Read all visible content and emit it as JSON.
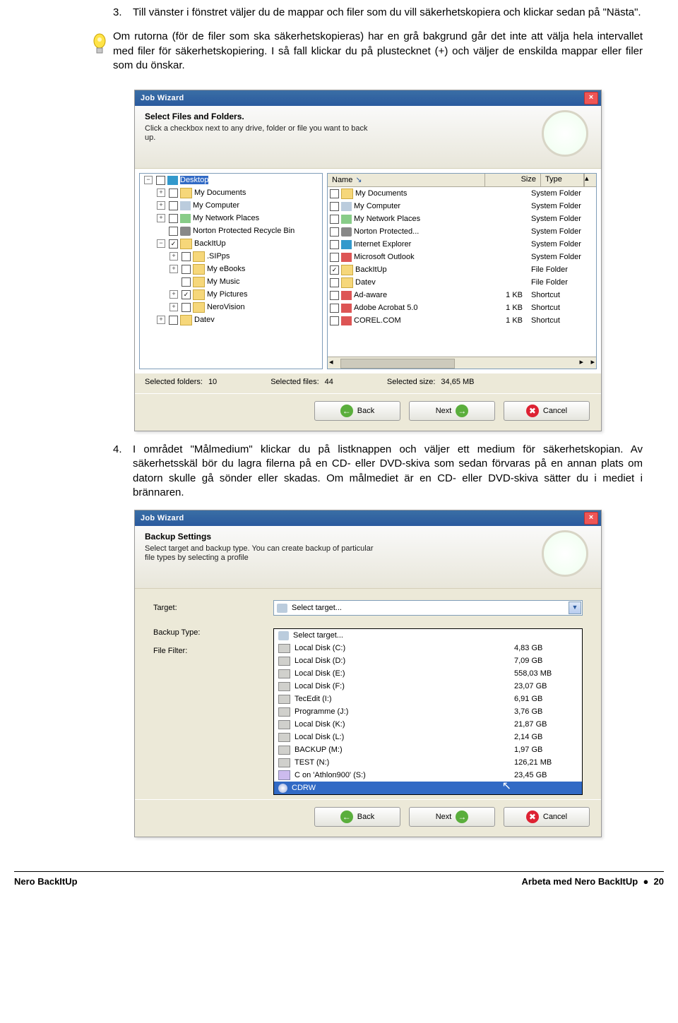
{
  "step3_num": "3.",
  "step3": "Till vänster i fönstret väljer du de mappar och filer som du vill säkerhetskopiera och klickar sedan på \"Nästa\".",
  "tip": "Om rutorna (för de filer som ska säkerhetskopieras) har en grå bakgrund går det inte att välja hela intervallet med filer för säkerhetskopiering. I så fall klickar du på plustecknet (+) och väljer de enskilda mappar eller filer som du önskar.",
  "wiz1": {
    "title": "Job Wizard",
    "btitle": "Select Files and Folders.",
    "bsub": "Click a checkbox next to any drive, folder or file you want to back up.",
    "cols": {
      "name": "Name",
      "size": "Size",
      "type": "Type"
    },
    "tree": [
      {
        "ind": 0,
        "exp": "−",
        "cb": "",
        "ico": "i-desktop",
        "label": "Desktop",
        "sel": true
      },
      {
        "ind": 1,
        "exp": "+",
        "cb": "",
        "ico": "i-folder",
        "label": "My Documents"
      },
      {
        "ind": 1,
        "exp": "+",
        "cb": "",
        "ico": "i-comp",
        "label": "My Computer"
      },
      {
        "ind": 1,
        "exp": "+",
        "cb": "",
        "ico": "i-net",
        "label": "My Network Places"
      },
      {
        "ind": 1,
        "exp": "",
        "cb": "",
        "ico": "i-bin",
        "label": "Norton Protected Recycle Bin"
      },
      {
        "ind": 1,
        "exp": "−",
        "cb": "✓",
        "ico": "i-folder",
        "label": "BackItUp"
      },
      {
        "ind": 2,
        "exp": "+",
        "cb": "",
        "ico": "i-folder",
        "label": ".SIPps"
      },
      {
        "ind": 2,
        "exp": "+",
        "cb": "",
        "ico": "i-folder",
        "label": "My eBooks"
      },
      {
        "ind": 2,
        "exp": "",
        "cb": "",
        "ico": "i-folder",
        "label": "My Music"
      },
      {
        "ind": 2,
        "exp": "+",
        "cb": "✓",
        "ico": "i-folder",
        "label": "My Pictures"
      },
      {
        "ind": 2,
        "exp": "+",
        "cb": "",
        "ico": "i-folder",
        "label": "NeroVision"
      },
      {
        "ind": 1,
        "exp": "+",
        "cb": "",
        "ico": "i-folder",
        "label": "Datev"
      }
    ],
    "list": [
      {
        "cb": "",
        "ico": "i-folder",
        "name": "My Documents",
        "size": "",
        "type": "System Folder"
      },
      {
        "cb": "",
        "ico": "i-comp",
        "name": "My Computer",
        "size": "",
        "type": "System Folder"
      },
      {
        "cb": "",
        "ico": "i-net",
        "name": "My Network Places",
        "size": "",
        "type": "System Folder"
      },
      {
        "cb": "",
        "ico": "i-bin",
        "name": "Norton Protected...",
        "size": "",
        "type": "System Folder"
      },
      {
        "cb": "",
        "ico": "i-desktop",
        "name": "Internet Explorer",
        "size": "",
        "type": "System Folder"
      },
      {
        "cb": "",
        "ico": "i-app",
        "name": "Microsoft Outlook",
        "size": "",
        "type": "System Folder"
      },
      {
        "cb": "✓",
        "ico": "i-folder",
        "name": "BackItUp",
        "size": "",
        "type": "File Folder"
      },
      {
        "cb": "",
        "ico": "i-folder",
        "name": "Datev",
        "size": "",
        "type": "File Folder"
      },
      {
        "cb": "",
        "ico": "i-app",
        "name": "Ad-aware",
        "size": "1 KB",
        "type": "Shortcut"
      },
      {
        "cb": "",
        "ico": "i-app",
        "name": "Adobe Acrobat 5.0",
        "size": "1 KB",
        "type": "Shortcut"
      },
      {
        "cb": "",
        "ico": "i-app",
        "name": "COREL.COM",
        "size": "1 KB",
        "type": "Shortcut"
      }
    ],
    "stats": {
      "sf_l": "Selected folders:",
      "sf_v": "10",
      "sfi_l": "Selected files:",
      "sfi_v": "44",
      "ss_l": "Selected size:",
      "ss_v": "34,65 MB"
    },
    "back": "Back",
    "next": "Next",
    "cancel": "Cancel"
  },
  "step4_num": "4.",
  "step4": "I området \"Målmedium\" klickar du på listknappen och väljer ett medium för säkerhetskopian. Av säkerhetsskäl bör du lagra filerna på en CD- eller DVD-skiva som sedan förvaras på en annan plats om datorn skulle gå sönder eller skadas. Om målmediet är en CD- eller DVD-skiva sätter du i mediet i brännaren.",
  "wiz2": {
    "title": "Job Wizard",
    "btitle": "Backup Settings",
    "bsub": "Select target and backup type. You can create backup of particular file types by selecting a profile",
    "target_l": "Target:",
    "target_v": "Select target...",
    "btype_l": "Backup Type:",
    "filter_l": "File Filter:",
    "dd": [
      {
        "ico": "i-target",
        "name": "Select target...",
        "size": ""
      },
      {
        "ico": "i-drive",
        "name": "Local Disk (C:)",
        "size": "4,83 GB"
      },
      {
        "ico": "i-drive",
        "name": "Local Disk (D:)",
        "size": "7,09 GB"
      },
      {
        "ico": "i-drive",
        "name": "Local Disk (E:)",
        "size": "558,03 MB"
      },
      {
        "ico": "i-drive",
        "name": "Local Disk (F:)",
        "size": "23,07 GB"
      },
      {
        "ico": "i-drive",
        "name": "TecEdit (I:)",
        "size": "6,91 GB"
      },
      {
        "ico": "i-drive",
        "name": "Programme (J:)",
        "size": "3,76 GB"
      },
      {
        "ico": "i-drive",
        "name": "Local Disk (K:)",
        "size": "21,87 GB"
      },
      {
        "ico": "i-drive",
        "name": "Local Disk (L:)",
        "size": "2,14 GB"
      },
      {
        "ico": "i-drive",
        "name": "BACKUP (M:)",
        "size": "1,97 GB"
      },
      {
        "ico": "i-drive",
        "name": "TEST (N:)",
        "size": "126,21 MB"
      },
      {
        "ico": "i-netdrive",
        "name": "C on 'Athlon900' (S:)",
        "size": "23,45 GB"
      },
      {
        "ico": "i-cd",
        "name": "CDRW",
        "size": "",
        "sel": true
      }
    ],
    "back": "Back",
    "next": "Next",
    "cancel": "Cancel"
  },
  "footer": {
    "left": "Nero BackItUp",
    "right_a": "Arbeta med Nero BackItUp",
    "bullet": "●",
    "page": "20"
  }
}
